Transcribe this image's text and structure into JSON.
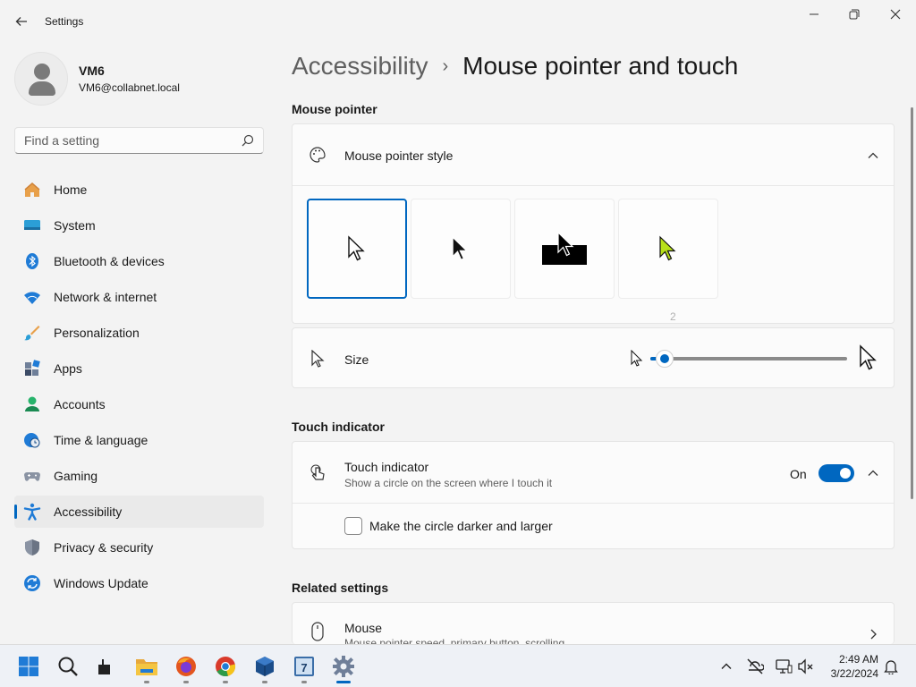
{
  "window": {
    "title": "Settings"
  },
  "user": {
    "name": "VM6",
    "email": "VM6@collabnet.local"
  },
  "search": {
    "placeholder": "Find a setting"
  },
  "sidebar": {
    "items": [
      {
        "label": "Home",
        "icon": "home-icon"
      },
      {
        "label": "System",
        "icon": "system-icon"
      },
      {
        "label": "Bluetooth & devices",
        "icon": "bluetooth-icon"
      },
      {
        "label": "Network & internet",
        "icon": "wifi-icon"
      },
      {
        "label": "Personalization",
        "icon": "brush-icon"
      },
      {
        "label": "Apps",
        "icon": "apps-icon"
      },
      {
        "label": "Accounts",
        "icon": "accounts-icon"
      },
      {
        "label": "Time & language",
        "icon": "globe-clock-icon"
      },
      {
        "label": "Gaming",
        "icon": "gamepad-icon"
      },
      {
        "label": "Accessibility",
        "icon": "accessibility-icon",
        "active": true
      },
      {
        "label": "Privacy & security",
        "icon": "shield-icon"
      },
      {
        "label": "Windows Update",
        "icon": "update-icon"
      }
    ]
  },
  "breadcrumb": {
    "parent": "Accessibility",
    "separator": "›",
    "current": "Mouse pointer and touch"
  },
  "mouse_pointer": {
    "section_title": "Mouse pointer",
    "style_label": "Mouse pointer style",
    "style_options": [
      {
        "name": "white",
        "selected": true
      },
      {
        "name": "black",
        "selected": false
      },
      {
        "name": "inverted",
        "selected": false
      },
      {
        "name": "custom",
        "selected": false
      }
    ],
    "size_label": "Size",
    "size_value": "2",
    "size_min": 1,
    "size_max": 15
  },
  "touch": {
    "section_title": "Touch indicator",
    "label": "Touch indicator",
    "description": "Show a circle on the screen where I touch it",
    "state_label": "On",
    "checkbox_label": "Make the circle darker and larger"
  },
  "related": {
    "section_title": "Related settings",
    "mouse_label": "Mouse",
    "mouse_desc": "Mouse pointer speed, primary button, scrolling"
  },
  "taskbar": {
    "time": "2:49 AM",
    "date": "3/22/2024"
  },
  "colors": {
    "accent": "#0067c0",
    "background": "#f3f3f3",
    "card": "#fbfbfb"
  }
}
